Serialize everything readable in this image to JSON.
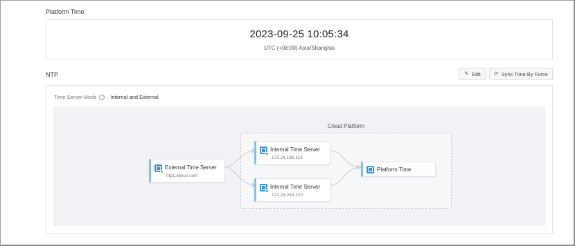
{
  "platform_time": {
    "section_title": "Platform Time",
    "current_time": "2023-09-25 10:05:34",
    "timezone": "UTC (+08:00) Asia/Shanghai"
  },
  "ntp": {
    "section_title": "NTP",
    "edit_label": "Edit",
    "sync_label": "Sync Time By Force",
    "mode_label": "Time Server Mode",
    "mode_value": "Internal and External",
    "diagram": {
      "cloud_label": "Cloud Platform",
      "external": {
        "title": "External Time Server",
        "address": "ntp1.aliyun.com",
        "icon": "globe-clock-icon"
      },
      "internal_1": {
        "title": "Internal Time Server",
        "address": "172.24.196.113",
        "icon": "server-icon"
      },
      "internal_2": {
        "title": "Internal Time Server",
        "address": "172.24.243.222",
        "icon": "server-icon"
      },
      "platform": {
        "title": "Platform Time",
        "icon": "monitor-icon"
      }
    }
  },
  "colors": {
    "accent": "#3d8fe0",
    "status_ok": "#3ec35c",
    "node_border": "#7cc0ee"
  }
}
